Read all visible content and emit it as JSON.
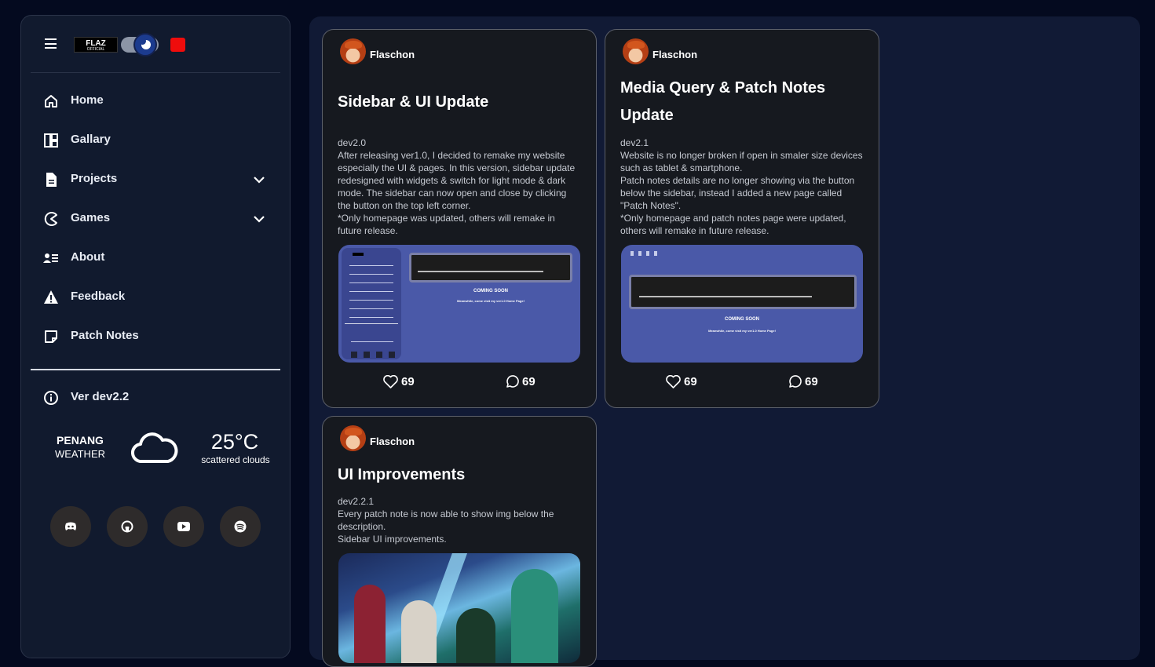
{
  "sidebar": {
    "logo_text": "FLAZ",
    "logo_sub": "OFFICIAL",
    "nav": [
      {
        "label": "Home",
        "icon": "home-icon",
        "has_chevron": false
      },
      {
        "label": "Gallary",
        "icon": "gallery-icon",
        "has_chevron": false
      },
      {
        "label": "Projects",
        "icon": "document-icon",
        "has_chevron": true
      },
      {
        "label": "Games",
        "icon": "pacman-icon",
        "has_chevron": true
      },
      {
        "label": "About",
        "icon": "about-icon",
        "has_chevron": false
      },
      {
        "label": "Feedback",
        "icon": "warning-icon",
        "has_chevron": false
      },
      {
        "label": "Patch Notes",
        "icon": "note-icon",
        "has_chevron": false
      }
    ],
    "version": "Ver dev2.2",
    "weather": {
      "city": "PENANG",
      "label": "WEATHER",
      "temp": "25°C",
      "desc": "scattered clouds"
    },
    "socials": [
      "discord-icon",
      "github-icon",
      "youtube-icon",
      "spotify-icon"
    ]
  },
  "posts": [
    {
      "author": "Flaschon",
      "title": "Sidebar & UI Update",
      "version": "dev2.0",
      "body": [
        "After releasing ver1.0, I decided to remake my website",
        "especially the UI & pages. In this version, sidebar update",
        "redesigned with widgets & switch for light mode & dark",
        "mode. The sidebar can now open and close by clicking",
        "the button on the top left corner.",
        "*Only homepage was updated, others will remake in",
        "future release."
      ],
      "likes": "69",
      "comments": "69",
      "shot": {
        "coming_soon": "COMING SOON",
        "message": "Meanwhile, come visit my ver1.0 Home Page!"
      }
    },
    {
      "author": "Flaschon",
      "title": "Media Query & Patch Notes Update",
      "version": "dev2.1",
      "body": [
        "Website is no longer broken if open in smaler size devices",
        "such as tablet & smartphone.",
        "Patch notes details are no longer showing via the button",
        "below the sidebar, instead I added a new page called",
        "\"Patch Notes\".",
        "*Only homepage and patch notes page were updated,",
        "others will remake in future release."
      ],
      "likes": "69",
      "comments": "69",
      "shot": {
        "coming_soon": "COMING SOON",
        "message": "Meanwhile, come visit my ver1.0 Home Page!"
      }
    },
    {
      "author": "Flaschon",
      "title": "UI Improvements",
      "version": "dev2.2.1",
      "body": [
        "Every patch note is now able to show img below the",
        "description.",
        "Sidebar UI improvements."
      ]
    }
  ],
  "colors": {
    "page_bg": "#040a1f",
    "sidebar_bg": "#111a2e",
    "main_bg": "#111a35",
    "card_bg": "#16191f",
    "accent_red": "#ef0c0c",
    "shot_bg": "#4a59a8"
  }
}
